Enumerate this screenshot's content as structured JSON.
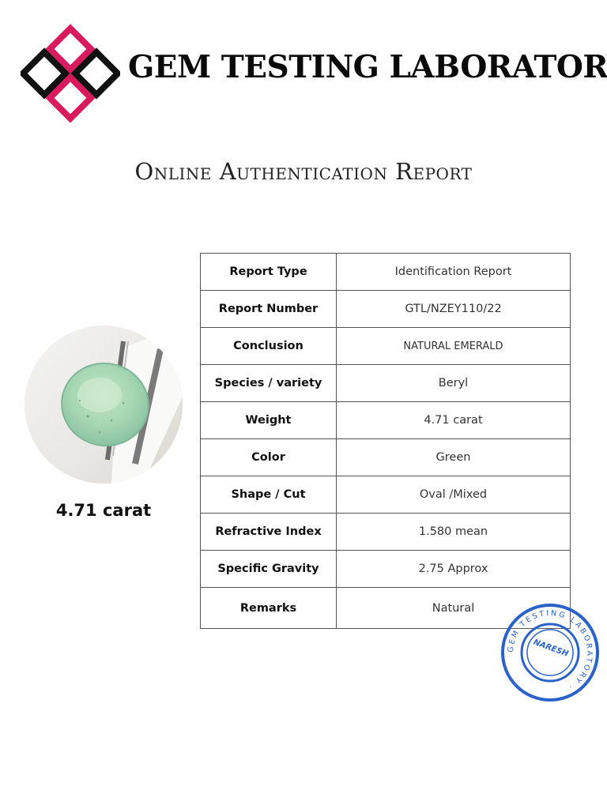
{
  "brand": {
    "name": "GEM TESTING LABORATORY"
  },
  "heading": "Online Authentication Report",
  "gem": {
    "weight_caption": "4.71 carat"
  },
  "report_table": {
    "rows": [
      {
        "label": "Report Type",
        "value": "Identification Report"
      },
      {
        "label": "Report Number",
        "value": "GTL/NZEY110/22"
      },
      {
        "label": "Conclusion",
        "value": "NATURAL EMERALD"
      },
      {
        "label": "Species / variety",
        "value": "Beryl"
      },
      {
        "label": "Weight",
        "value": "4.71 carat"
      },
      {
        "label": "Color",
        "value": "Green"
      },
      {
        "label": "Shape / Cut",
        "value": "Oval /Mixed"
      },
      {
        "label": "Refractive Index",
        "value": "1.580 mean"
      },
      {
        "label": "Specific Gravity",
        "value": "2.75 Approx"
      },
      {
        "label": "Remarks",
        "value": "Natural"
      }
    ]
  },
  "stamp": {
    "ring_text": "GEM TESTING LABORATORY",
    "signature": "NARESH",
    "color": "#2a62c9"
  },
  "colors": {
    "logo_accent": "#d81b5e",
    "logo_dark": "#111111",
    "gem_green": "#a6d6b4"
  }
}
